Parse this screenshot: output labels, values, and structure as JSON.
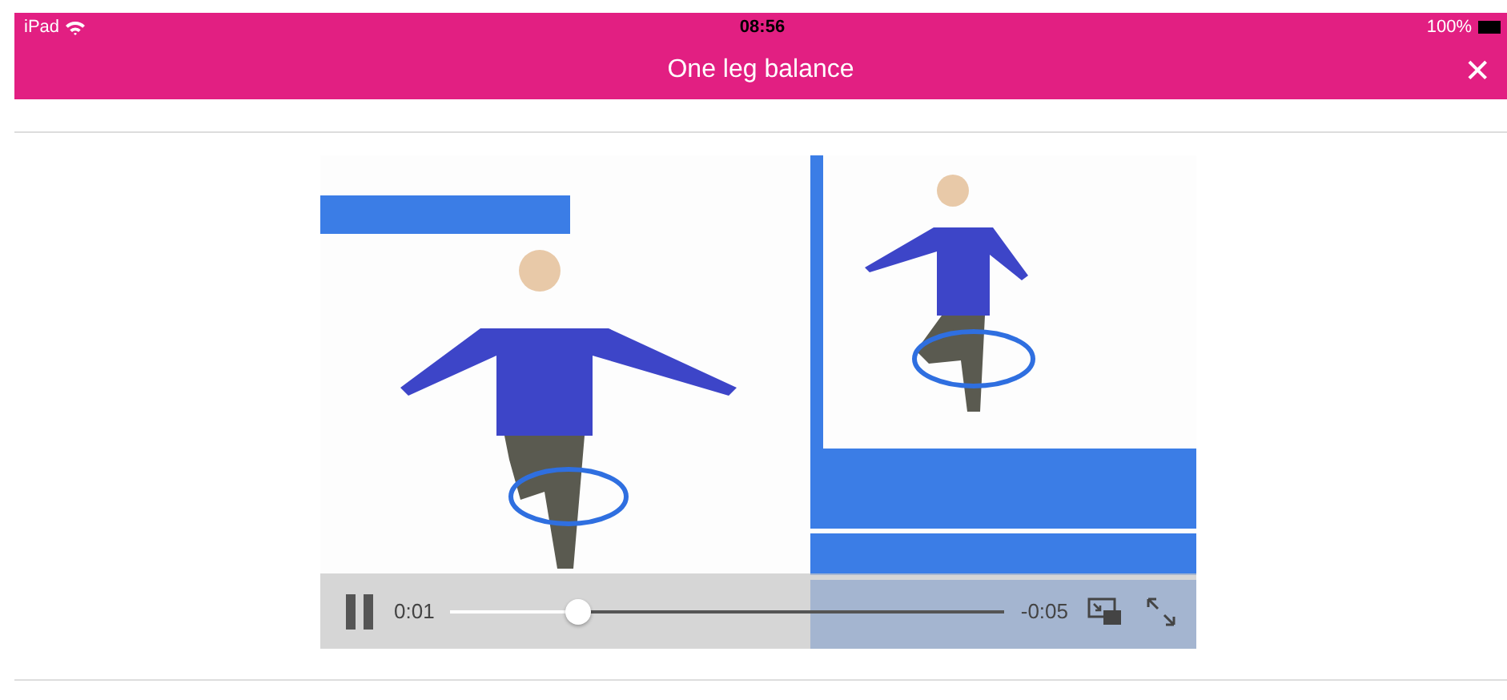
{
  "status_bar": {
    "device": "iPad",
    "time": "08:56",
    "battery": "100%"
  },
  "nav_bar": {
    "title": "One leg balance",
    "close": "✕"
  },
  "video": {
    "kind": "picture",
    "playing": true,
    "elapsed": "0:01",
    "remaining": "-0:05",
    "level": 0.23
  }
}
